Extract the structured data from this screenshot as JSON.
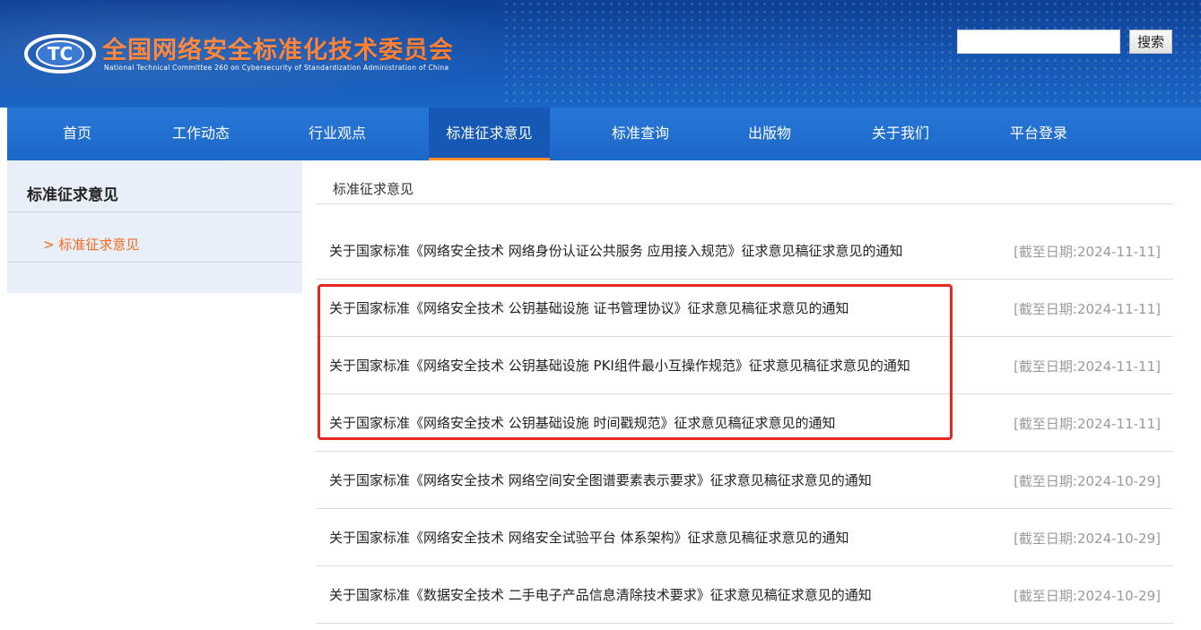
{
  "header": {
    "title": "全国网络安全标准化技术委员会",
    "subtitle": "National Technical Committee 260 on Cybersecurity of Standardization Administration of China",
    "logo_text": "TC",
    "search": {
      "value": "",
      "placeholder": "",
      "button_label": "搜索"
    }
  },
  "nav": {
    "items": [
      {
        "label": "首页"
      },
      {
        "label": "工作动态"
      },
      {
        "label": "行业观点"
      },
      {
        "label": "标准征求意见"
      },
      {
        "label": "标准查询"
      },
      {
        "label": "出版物"
      },
      {
        "label": "关于我们"
      },
      {
        "label": "平台登录"
      }
    ],
    "active_index": 3
  },
  "sidebar": {
    "title": "标准征求意见",
    "items": [
      {
        "label": "> 标准征求意见"
      }
    ]
  },
  "main": {
    "heading": "标准征求意见",
    "rows": [
      {
        "title": "关于国家标准《网络安全技术 网络身份认证公共服务 应用接入规范》征求意见稿征求意见的通知",
        "date": "[截至日期:2024-11-11]"
      },
      {
        "title": "关于国家标准《网络安全技术 公钥基础设施 证书管理协议》征求意见稿征求意见的通知",
        "date": "[截至日期:2024-11-11]"
      },
      {
        "title": "关于国家标准《网络安全技术 公钥基础设施 PKI组件最小互操作规范》征求意见稿征求意见的通知",
        "date": "[截至日期:2024-11-11]"
      },
      {
        "title": "关于国家标准《网络安全技术 公钥基础设施 时间戳规范》征求意见稿征求意见的通知",
        "date": "[截至日期:2024-11-11]"
      },
      {
        "title": "关于国家标准《网络安全技术 网络空间安全图谱要素表示要求》征求意见稿征求意见的通知",
        "date": "[截至日期:2024-10-29]"
      },
      {
        "title": "关于国家标准《网络安全技术 网络安全试验平台 体系架构》征求意见稿征求意见的通知",
        "date": "[截至日期:2024-10-29]"
      },
      {
        "title": "关于国家标准《数据安全技术 二手电子产品信息清除技术要求》征求意见稿征求意见的通知",
        "date": "[截至日期:2024-10-29]"
      }
    ]
  },
  "colors": {
    "header_blue": "#1557b4",
    "nav_blue": "#1f6fd1",
    "accent_orange": "#ff7a2a",
    "active_underline": "#ff8a2a",
    "sidebar_bg": "#e9eff8",
    "date_gray": "#9a9a9a",
    "highlight_red": "#e8271f"
  }
}
